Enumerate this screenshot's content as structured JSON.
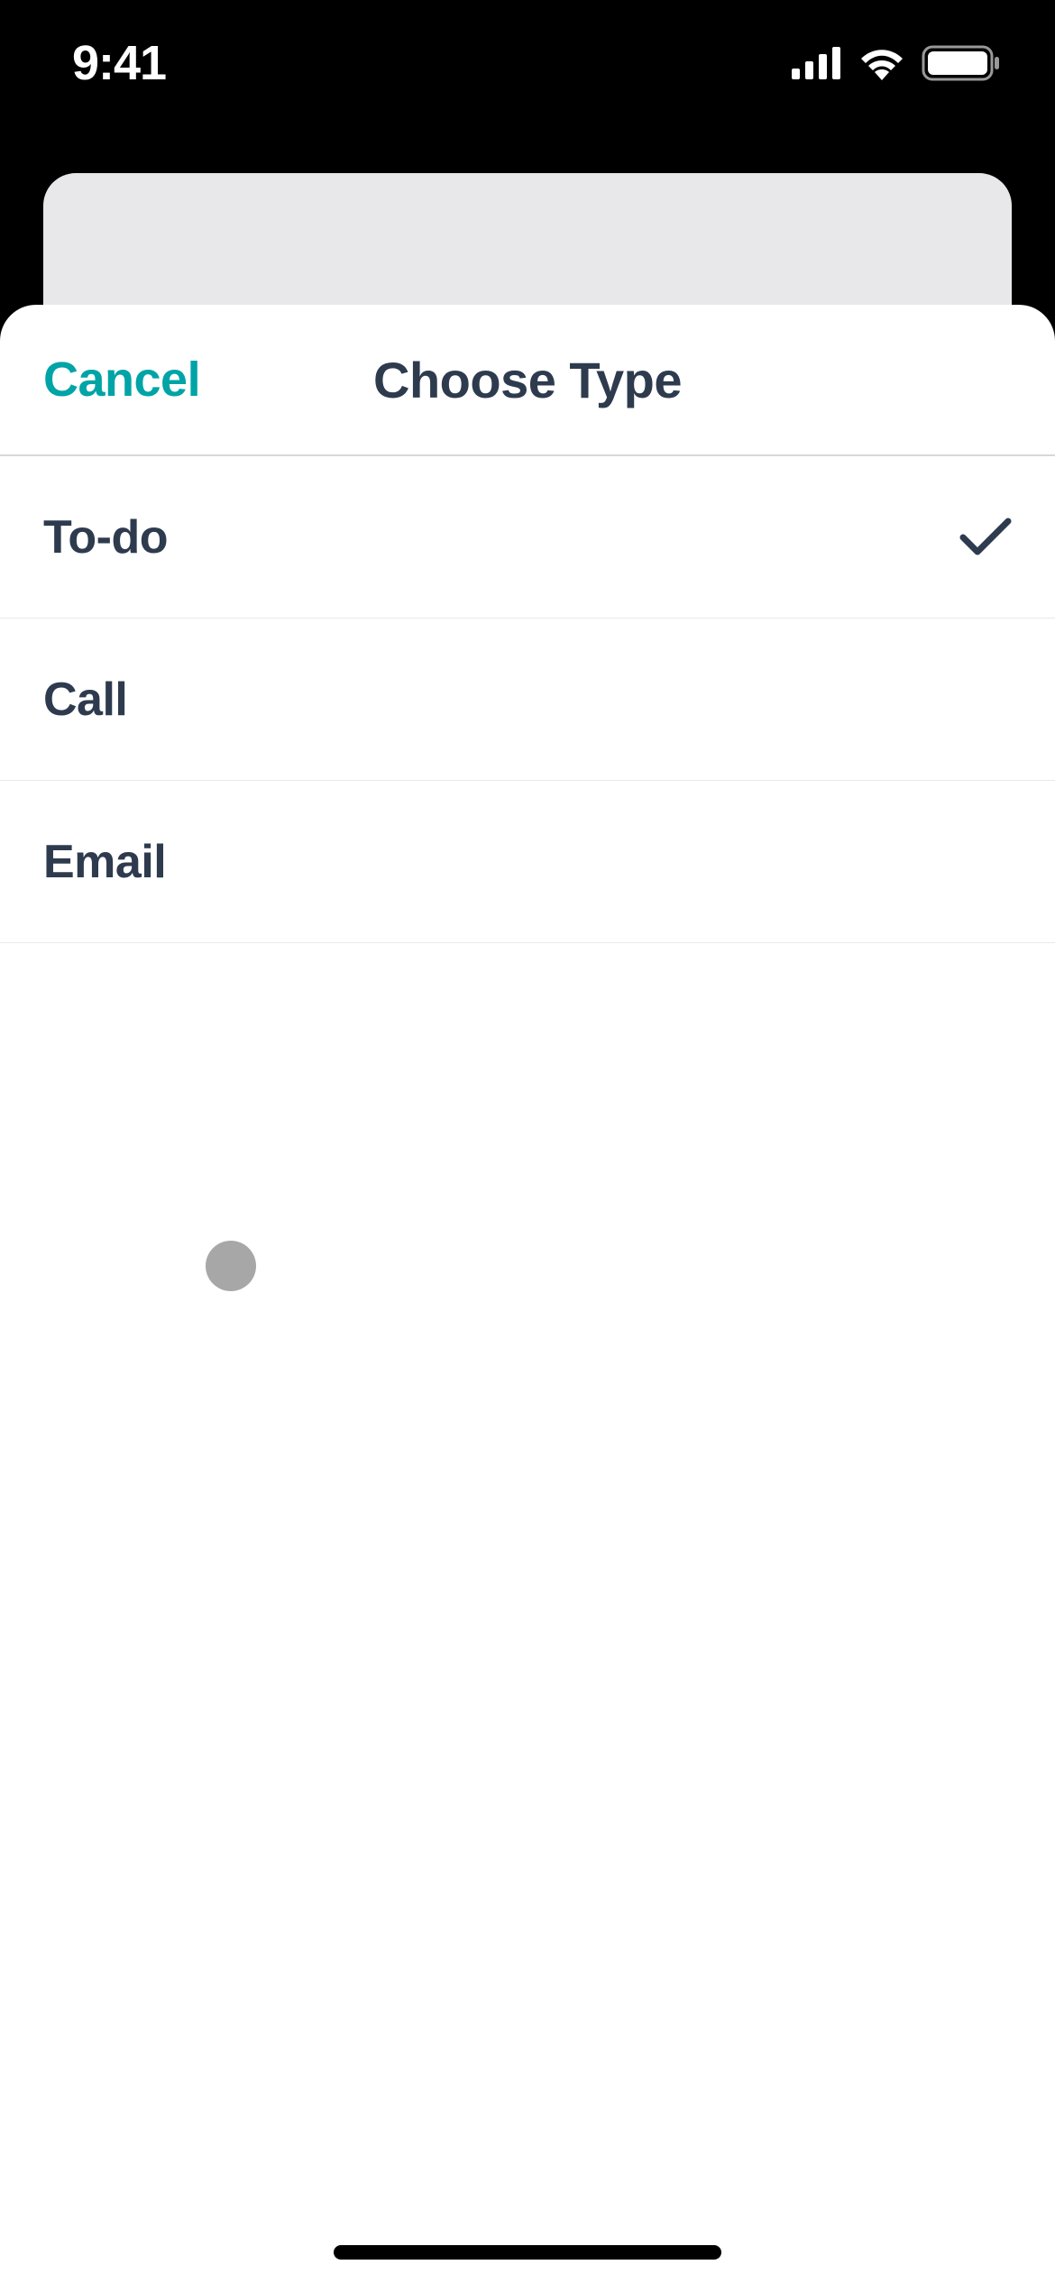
{
  "status": {
    "time": "9:41"
  },
  "sheet": {
    "cancel_label": "Cancel",
    "title": "Choose Type"
  },
  "types": [
    {
      "label": "To-do",
      "selected": true
    },
    {
      "label": "Call",
      "selected": false
    },
    {
      "label": "Email",
      "selected": false
    }
  ],
  "colors": {
    "accent": "#00a4a6",
    "text_primary": "#2e3b4e"
  }
}
